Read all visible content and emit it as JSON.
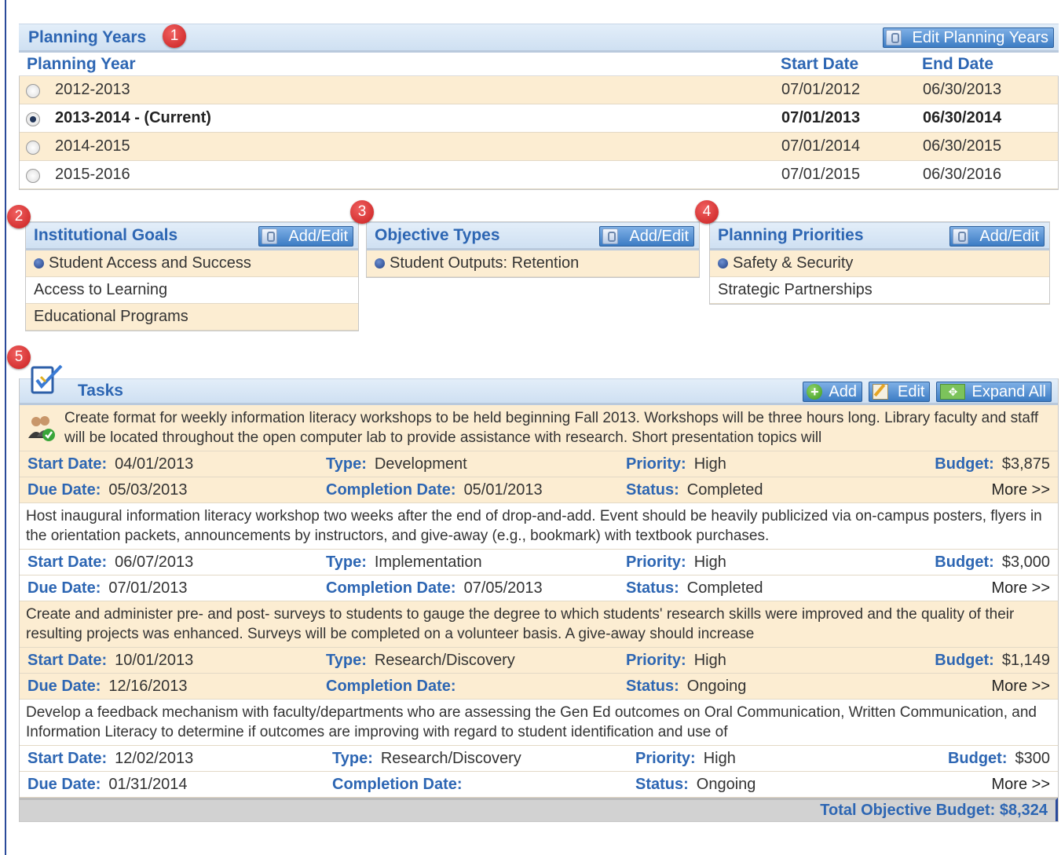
{
  "planning_years": {
    "title": "Planning Years",
    "badge": "1",
    "edit_button": "Edit Planning Years",
    "columns": {
      "year": "Planning Year",
      "start": "Start Date",
      "end": "End Date"
    },
    "rows": [
      {
        "year": "2012-2013",
        "start": "07/01/2012",
        "end": "06/30/2013",
        "selected": false
      },
      {
        "year": "2013-2014 - (Current)",
        "start": "07/01/2013",
        "end": "06/30/2014",
        "selected": true
      },
      {
        "year": "2014-2015",
        "start": "07/01/2014",
        "end": "06/30/2015",
        "selected": false
      },
      {
        "year": "2015-2016",
        "start": "07/01/2015",
        "end": "06/30/2016",
        "selected": false
      }
    ]
  },
  "institutional_goals": {
    "badge": "2",
    "title": "Institutional Goals",
    "button": "Add/Edit",
    "items": [
      "Student Access and Success",
      "Access to Learning",
      "Educational Programs"
    ]
  },
  "objective_types": {
    "badge": "3",
    "title": "Objective Types",
    "button": "Add/Edit",
    "items": [
      "Student Outputs: Retention"
    ]
  },
  "planning_priorities": {
    "badge": "4",
    "title": "Planning Priorities",
    "button": "Add/Edit",
    "items": [
      "Safety & Security",
      "Strategic Partnerships"
    ]
  },
  "tasks": {
    "badge": "5",
    "title": "Tasks",
    "buttons": {
      "add": "Add",
      "edit": "Edit",
      "expand": "Expand All"
    },
    "labels": {
      "start": "Start Date:",
      "type": "Type:",
      "priority": "Priority:",
      "budget": "Budget:",
      "due": "Due Date:",
      "completion": "Completion Date:",
      "status": "Status:",
      "more": "More >>"
    },
    "items": [
      {
        "desc": "Create format for weekly information literacy workshops to be held beginning Fall 2013. Workshops will be three hours long. Library faculty and staff will be located throughout the open computer lab to provide assistance with research. Short presentation topics will",
        "start": "04/01/2013",
        "type": "Development",
        "priority": "High",
        "budget": "$3,875",
        "due": "05/03/2013",
        "completion": "05/01/2013",
        "status": "Completed"
      },
      {
        "desc": "Host inaugural information literacy workshop two weeks after the end of drop-and-add. Event should be heavily publicized via on-campus posters, flyers in the orientation packets, announcements by instructors, and give-away (e.g., bookmark) with textbook purchases.",
        "start": "06/07/2013",
        "type": "Implementation",
        "priority": "High",
        "budget": "$3,000",
        "due": "07/01/2013",
        "completion": "07/05/2013",
        "status": "Completed"
      },
      {
        "desc": "Create and administer pre- and post- surveys to students to gauge the degree to which students' research skills were improved and the quality of their resulting projects was enhanced. Surveys will be completed on a volunteer basis. A give-away should increase",
        "start": "10/01/2013",
        "type": "Research/Discovery",
        "priority": "High",
        "budget": "$1,149",
        "due": "12/16/2013",
        "completion": "",
        "status": "Ongoing"
      },
      {
        "desc": "Develop a feedback mechanism with faculty/departments who are assessing the Gen Ed outcomes on Oral Communication, Written Communication, and Information Literacy to determine if outcomes are improving with regard to student identification and use of",
        "start": "12/02/2013",
        "type": "Research/Discovery",
        "priority": "High",
        "budget": "$300",
        "due": "01/31/2014",
        "completion": "",
        "status": "Ongoing"
      }
    ],
    "total": "Total Objective Budget: $8,324"
  },
  "colors": {
    "accent": "#2d66b3",
    "row_alt": "#fcedd2",
    "badge": "#d62b2b"
  }
}
